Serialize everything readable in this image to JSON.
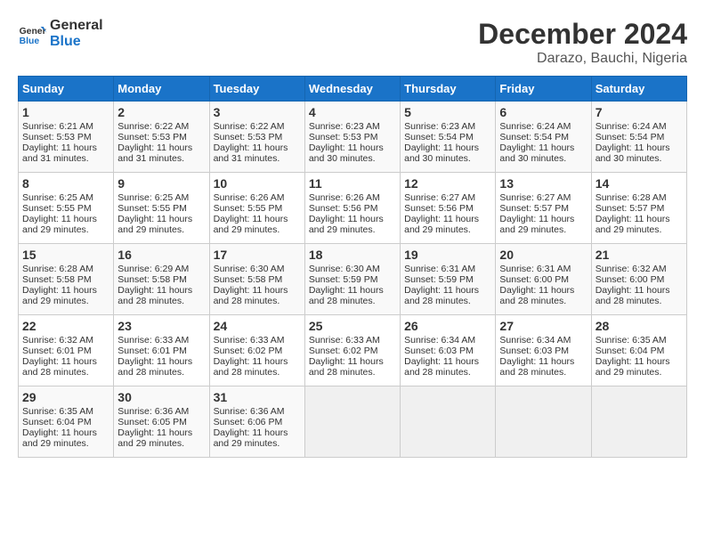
{
  "header": {
    "logo_line1": "General",
    "logo_line2": "Blue",
    "month": "December 2024",
    "location": "Darazo, Bauchi, Nigeria"
  },
  "weekdays": [
    "Sunday",
    "Monday",
    "Tuesday",
    "Wednesday",
    "Thursday",
    "Friday",
    "Saturday"
  ],
  "weeks": [
    [
      {
        "day": "1",
        "lines": [
          "Sunrise: 6:21 AM",
          "Sunset: 5:53 PM",
          "Daylight: 11 hours",
          "and 31 minutes."
        ]
      },
      {
        "day": "2",
        "lines": [
          "Sunrise: 6:22 AM",
          "Sunset: 5:53 PM",
          "Daylight: 11 hours",
          "and 31 minutes."
        ]
      },
      {
        "day": "3",
        "lines": [
          "Sunrise: 6:22 AM",
          "Sunset: 5:53 PM",
          "Daylight: 11 hours",
          "and 31 minutes."
        ]
      },
      {
        "day": "4",
        "lines": [
          "Sunrise: 6:23 AM",
          "Sunset: 5:53 PM",
          "Daylight: 11 hours",
          "and 30 minutes."
        ]
      },
      {
        "day": "5",
        "lines": [
          "Sunrise: 6:23 AM",
          "Sunset: 5:54 PM",
          "Daylight: 11 hours",
          "and 30 minutes."
        ]
      },
      {
        "day": "6",
        "lines": [
          "Sunrise: 6:24 AM",
          "Sunset: 5:54 PM",
          "Daylight: 11 hours",
          "and 30 minutes."
        ]
      },
      {
        "day": "7",
        "lines": [
          "Sunrise: 6:24 AM",
          "Sunset: 5:54 PM",
          "Daylight: 11 hours",
          "and 30 minutes."
        ]
      }
    ],
    [
      {
        "day": "8",
        "lines": [
          "Sunrise: 6:25 AM",
          "Sunset: 5:55 PM",
          "Daylight: 11 hours",
          "and 29 minutes."
        ]
      },
      {
        "day": "9",
        "lines": [
          "Sunrise: 6:25 AM",
          "Sunset: 5:55 PM",
          "Daylight: 11 hours",
          "and 29 minutes."
        ]
      },
      {
        "day": "10",
        "lines": [
          "Sunrise: 6:26 AM",
          "Sunset: 5:55 PM",
          "Daylight: 11 hours",
          "and 29 minutes."
        ]
      },
      {
        "day": "11",
        "lines": [
          "Sunrise: 6:26 AM",
          "Sunset: 5:56 PM",
          "Daylight: 11 hours",
          "and 29 minutes."
        ]
      },
      {
        "day": "12",
        "lines": [
          "Sunrise: 6:27 AM",
          "Sunset: 5:56 PM",
          "Daylight: 11 hours",
          "and 29 minutes."
        ]
      },
      {
        "day": "13",
        "lines": [
          "Sunrise: 6:27 AM",
          "Sunset: 5:57 PM",
          "Daylight: 11 hours",
          "and 29 minutes."
        ]
      },
      {
        "day": "14",
        "lines": [
          "Sunrise: 6:28 AM",
          "Sunset: 5:57 PM",
          "Daylight: 11 hours",
          "and 29 minutes."
        ]
      }
    ],
    [
      {
        "day": "15",
        "lines": [
          "Sunrise: 6:28 AM",
          "Sunset: 5:58 PM",
          "Daylight: 11 hours",
          "and 29 minutes."
        ]
      },
      {
        "day": "16",
        "lines": [
          "Sunrise: 6:29 AM",
          "Sunset: 5:58 PM",
          "Daylight: 11 hours",
          "and 28 minutes."
        ]
      },
      {
        "day": "17",
        "lines": [
          "Sunrise: 6:30 AM",
          "Sunset: 5:58 PM",
          "Daylight: 11 hours",
          "and 28 minutes."
        ]
      },
      {
        "day": "18",
        "lines": [
          "Sunrise: 6:30 AM",
          "Sunset: 5:59 PM",
          "Daylight: 11 hours",
          "and 28 minutes."
        ]
      },
      {
        "day": "19",
        "lines": [
          "Sunrise: 6:31 AM",
          "Sunset: 5:59 PM",
          "Daylight: 11 hours",
          "and 28 minutes."
        ]
      },
      {
        "day": "20",
        "lines": [
          "Sunrise: 6:31 AM",
          "Sunset: 6:00 PM",
          "Daylight: 11 hours",
          "and 28 minutes."
        ]
      },
      {
        "day": "21",
        "lines": [
          "Sunrise: 6:32 AM",
          "Sunset: 6:00 PM",
          "Daylight: 11 hours",
          "and 28 minutes."
        ]
      }
    ],
    [
      {
        "day": "22",
        "lines": [
          "Sunrise: 6:32 AM",
          "Sunset: 6:01 PM",
          "Daylight: 11 hours",
          "and 28 minutes."
        ]
      },
      {
        "day": "23",
        "lines": [
          "Sunrise: 6:33 AM",
          "Sunset: 6:01 PM",
          "Daylight: 11 hours",
          "and 28 minutes."
        ]
      },
      {
        "day": "24",
        "lines": [
          "Sunrise: 6:33 AM",
          "Sunset: 6:02 PM",
          "Daylight: 11 hours",
          "and 28 minutes."
        ]
      },
      {
        "day": "25",
        "lines": [
          "Sunrise: 6:33 AM",
          "Sunset: 6:02 PM",
          "Daylight: 11 hours",
          "and 28 minutes."
        ]
      },
      {
        "day": "26",
        "lines": [
          "Sunrise: 6:34 AM",
          "Sunset: 6:03 PM",
          "Daylight: 11 hours",
          "and 28 minutes."
        ]
      },
      {
        "day": "27",
        "lines": [
          "Sunrise: 6:34 AM",
          "Sunset: 6:03 PM",
          "Daylight: 11 hours",
          "and 28 minutes."
        ]
      },
      {
        "day": "28",
        "lines": [
          "Sunrise: 6:35 AM",
          "Sunset: 6:04 PM",
          "Daylight: 11 hours",
          "and 29 minutes."
        ]
      }
    ],
    [
      {
        "day": "29",
        "lines": [
          "Sunrise: 6:35 AM",
          "Sunset: 6:04 PM",
          "Daylight: 11 hours",
          "and 29 minutes."
        ]
      },
      {
        "day": "30",
        "lines": [
          "Sunrise: 6:36 AM",
          "Sunset: 6:05 PM",
          "Daylight: 11 hours",
          "and 29 minutes."
        ]
      },
      {
        "day": "31",
        "lines": [
          "Sunrise: 6:36 AM",
          "Sunset: 6:06 PM",
          "Daylight: 11 hours",
          "and 29 minutes."
        ]
      },
      {
        "day": "",
        "lines": []
      },
      {
        "day": "",
        "lines": []
      },
      {
        "day": "",
        "lines": []
      },
      {
        "day": "",
        "lines": []
      }
    ]
  ]
}
